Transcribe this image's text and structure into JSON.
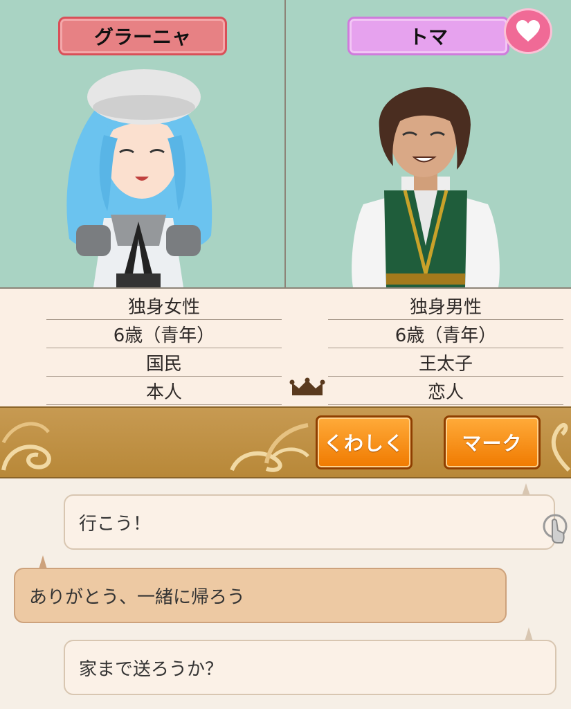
{
  "left_character": {
    "name": "グラーニャ",
    "stats": [
      "独身女性",
      "6歳（青年）",
      "国民",
      "本人"
    ]
  },
  "right_character": {
    "name": "トマ",
    "stats": [
      "独身男性",
      "6歳（青年）",
      "王太子",
      "恋人"
    ]
  },
  "buttons": {
    "detail_label": "くわしく",
    "mark_label": "マーク"
  },
  "chat": {
    "messages": [
      {
        "text": "行こう！"
      },
      {
        "text": "ありがとう、一緒に帰ろう"
      },
      {
        "text": "家まで送ろうか？"
      }
    ]
  },
  "icons": {
    "favorite": "heart-icon",
    "relationship": "crown-icon",
    "advance": "tap-icon"
  },
  "colors": {
    "left_name_tag": "#e78184",
    "right_name_tag": "#e6a2ee",
    "heart": "#f06a96",
    "button_orange": "#f07a00",
    "bar_gold": "#c79a52",
    "portrait_bg": "#a9d3c3"
  }
}
